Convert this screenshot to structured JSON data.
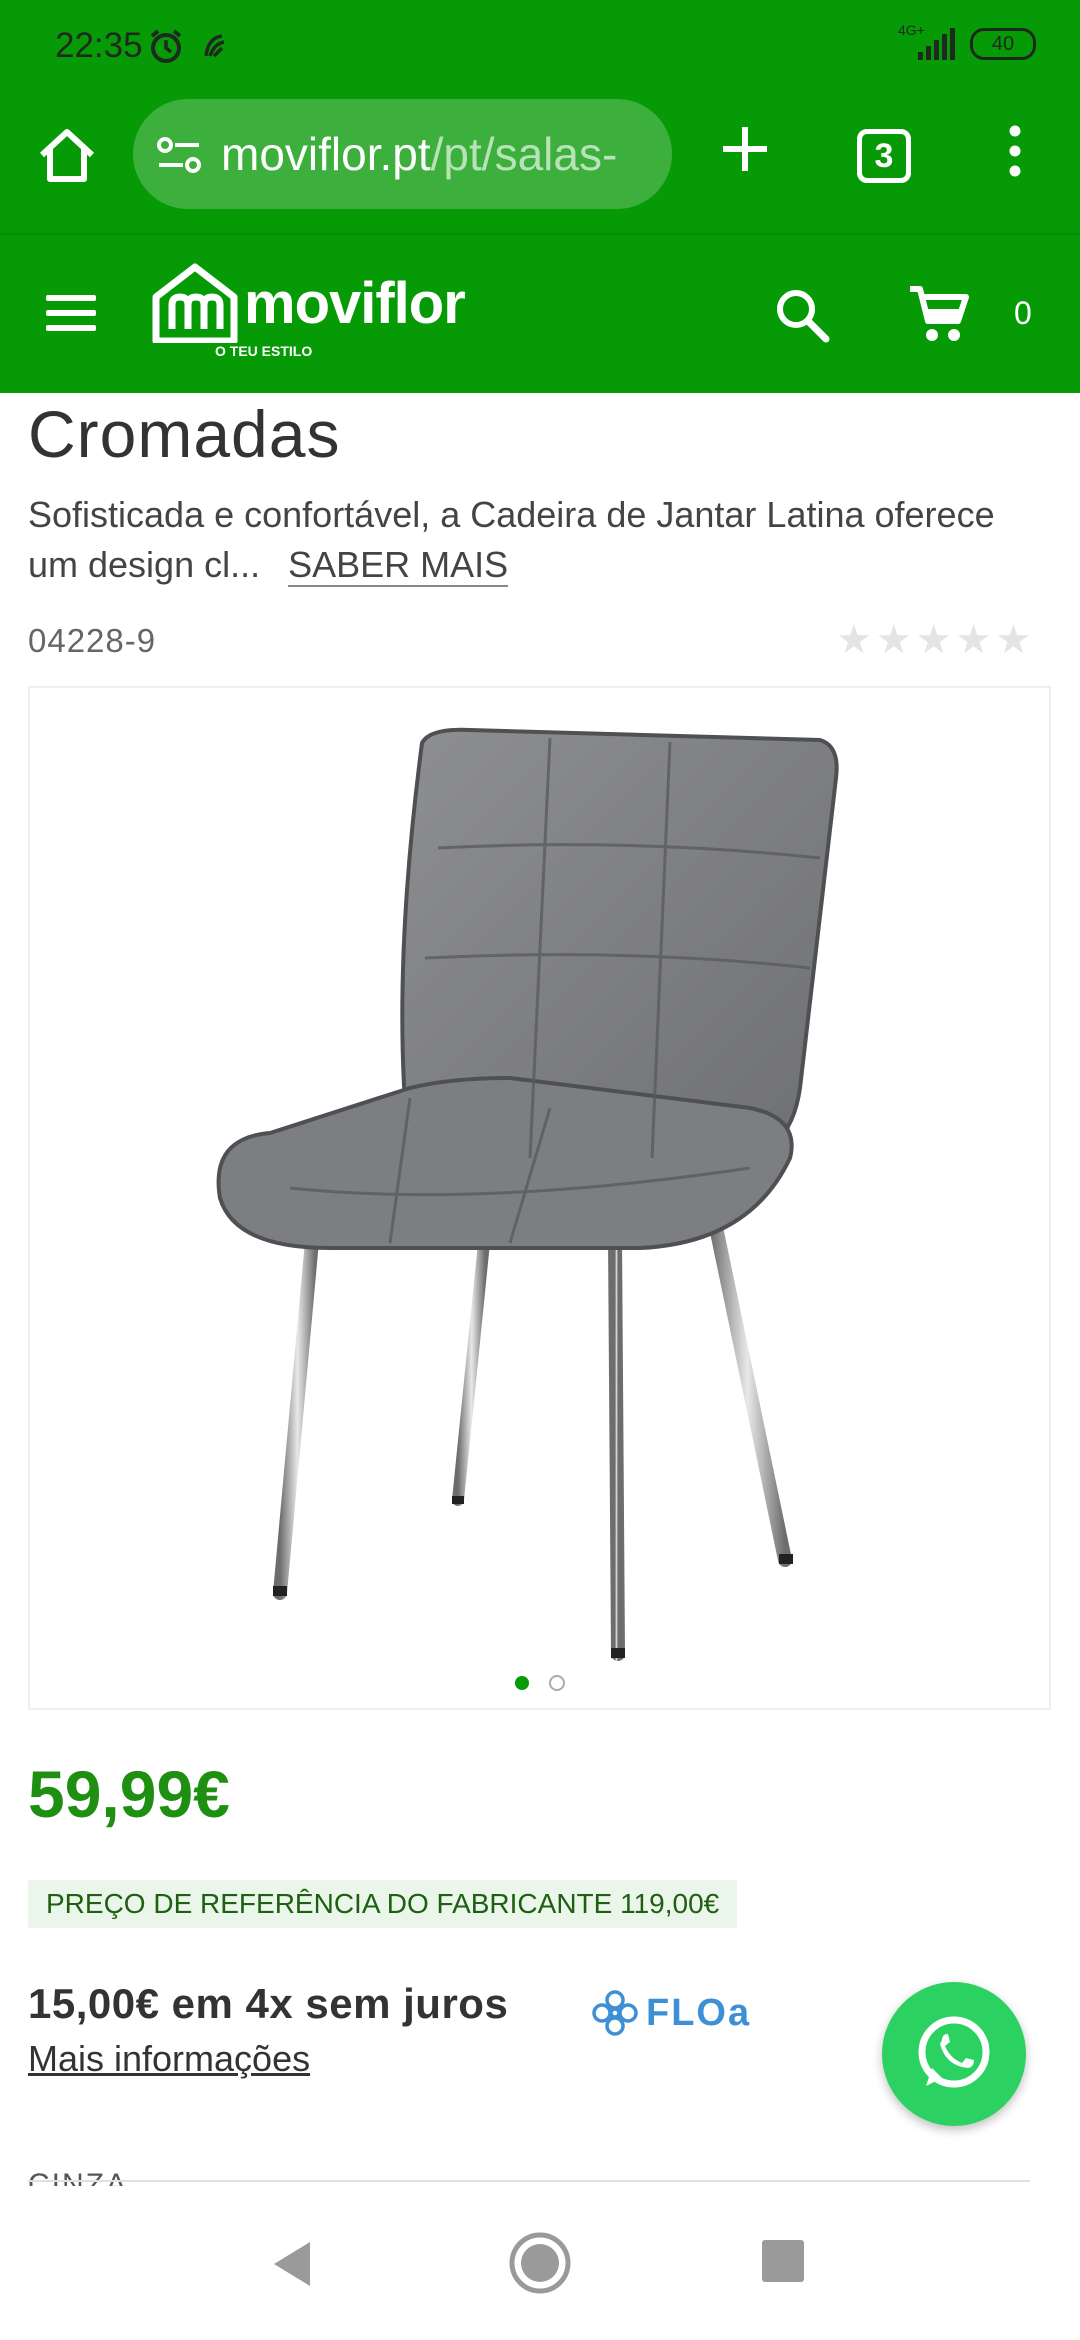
{
  "status_bar": {
    "time": "22:35",
    "network": "4G+",
    "battery": "40",
    "icons": [
      "alarm-icon",
      "nfc-icon",
      "signal-icon",
      "battery-icon"
    ]
  },
  "browser": {
    "url_host": "moviflor.pt",
    "url_path": "/pt/salas-",
    "tab_count": "3"
  },
  "site_header": {
    "logo_text": "moviflor",
    "logo_tagline": "O TEU ESTILO",
    "cart_count": "0"
  },
  "product": {
    "title": "Cromadas",
    "description": "Sofisticada e confortável, a Cadeira de Jantar Latina oferece um design cl...",
    "read_more": "SABER MAIS",
    "sku": "04228-9",
    "rating_stars": 0,
    "rating_max": 5,
    "image_count": 2,
    "image_active": 1,
    "price": "59,99€",
    "reference_price": "PREÇO DE REFERÊNCIA DO FABRICANTE 119,00€",
    "installments": "15,00€ em 4x sem juros",
    "installments_provider": "FLOa",
    "more_info": "Mais informações",
    "partial_next_label": "CINZA"
  },
  "colors": {
    "brand_green": "#079a07",
    "price_green": "#1f8f12",
    "whatsapp_green": "#2bd161"
  }
}
